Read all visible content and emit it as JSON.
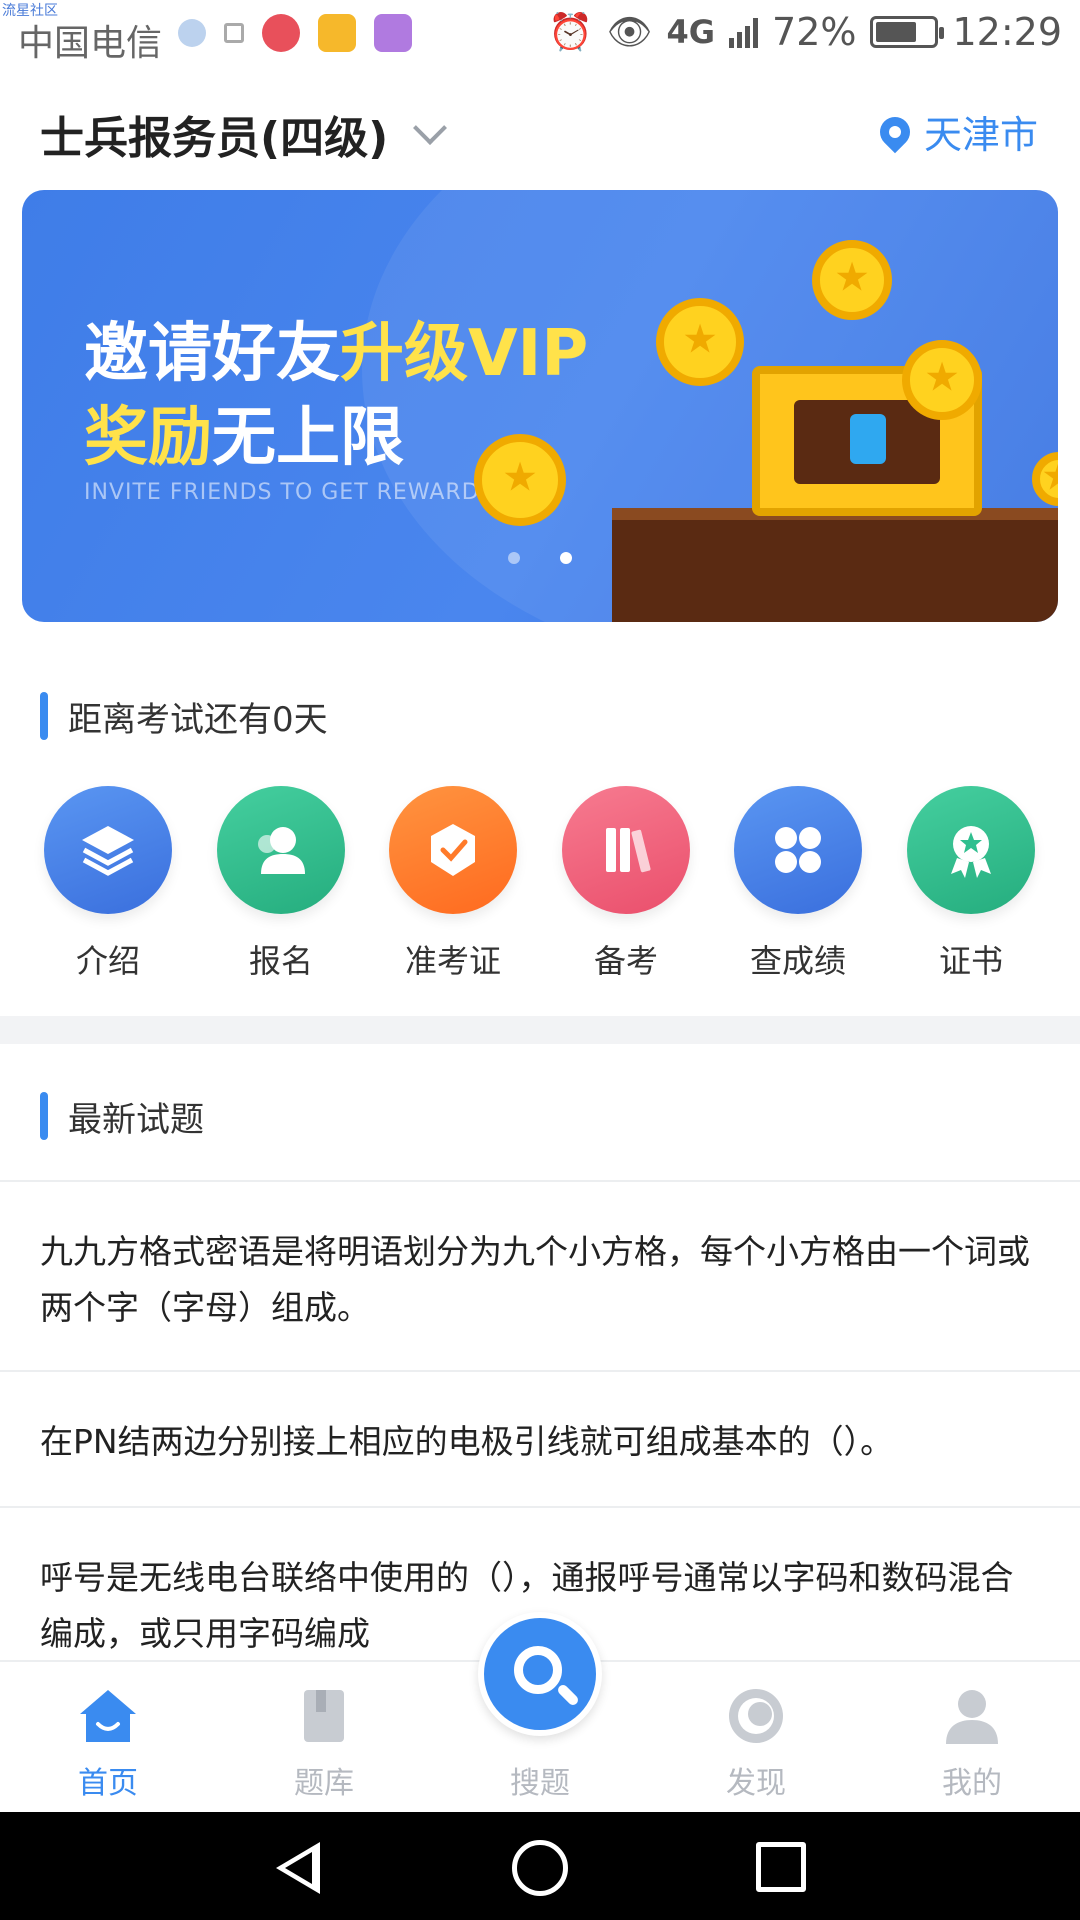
{
  "status_bar": {
    "watermark": "流星社区",
    "carrier": "中国电信",
    "network": "4G",
    "network_sub": "4G 2G",
    "battery_percent": "72%",
    "battery_level": 0.72,
    "time": "12:29",
    "icons": [
      "fps-icon",
      "upload-icon",
      "cartoon-app-icon",
      "folder-app-icon",
      "gallery-app-icon",
      "alarm-icon",
      "eye-icon",
      "signal-icon",
      "battery-icon"
    ]
  },
  "header": {
    "exam_title": "士兵报务员(四级)",
    "location": "天津市"
  },
  "banner": {
    "line1_white": "邀请好友",
    "line1_yellow": "升级VIP",
    "line2_yellow": "奖励",
    "line2_white": "无上限",
    "subtitle": "INVITE FRIENDS TO GET REWARDS",
    "dots": 2,
    "active_dot": 2
  },
  "countdown": {
    "title": "距离考试还有0天"
  },
  "shortcuts": [
    {
      "label": "介绍",
      "icon": "layers-icon",
      "color": "#3f7de8"
    },
    {
      "label": "报名",
      "icon": "person-icon",
      "color": "#2fbf8f"
    },
    {
      "label": "准考证",
      "icon": "ticket-icon",
      "color": "#ff7a2a"
    },
    {
      "label": "备考",
      "icon": "books-icon",
      "color": "#f2607a"
    },
    {
      "label": "查成绩",
      "icon": "grid-icon",
      "color": "#4a86ee"
    },
    {
      "label": "证书",
      "icon": "badge-icon",
      "color": "#2fbf8f"
    }
  ],
  "latest": {
    "title": "最新试题",
    "questions": [
      "九九方格式密语是将明语划分为九个小方格，每个小方格由一个词或两个字（字母）组成。",
      "在PN结两边分别接上相应的电极引线就可组成基本的（）。",
      "呼号是无线电台联络中使用的（），通报呼号通常以字码和数码混合编成，或只用字码编成"
    ]
  },
  "bottom_nav": {
    "items": [
      "首页",
      "题库",
      "搜题",
      "发现",
      "我的"
    ],
    "active": "首页"
  },
  "colors": {
    "accent": "#3a8bf0",
    "banner_yellow": "#ffe24a"
  }
}
